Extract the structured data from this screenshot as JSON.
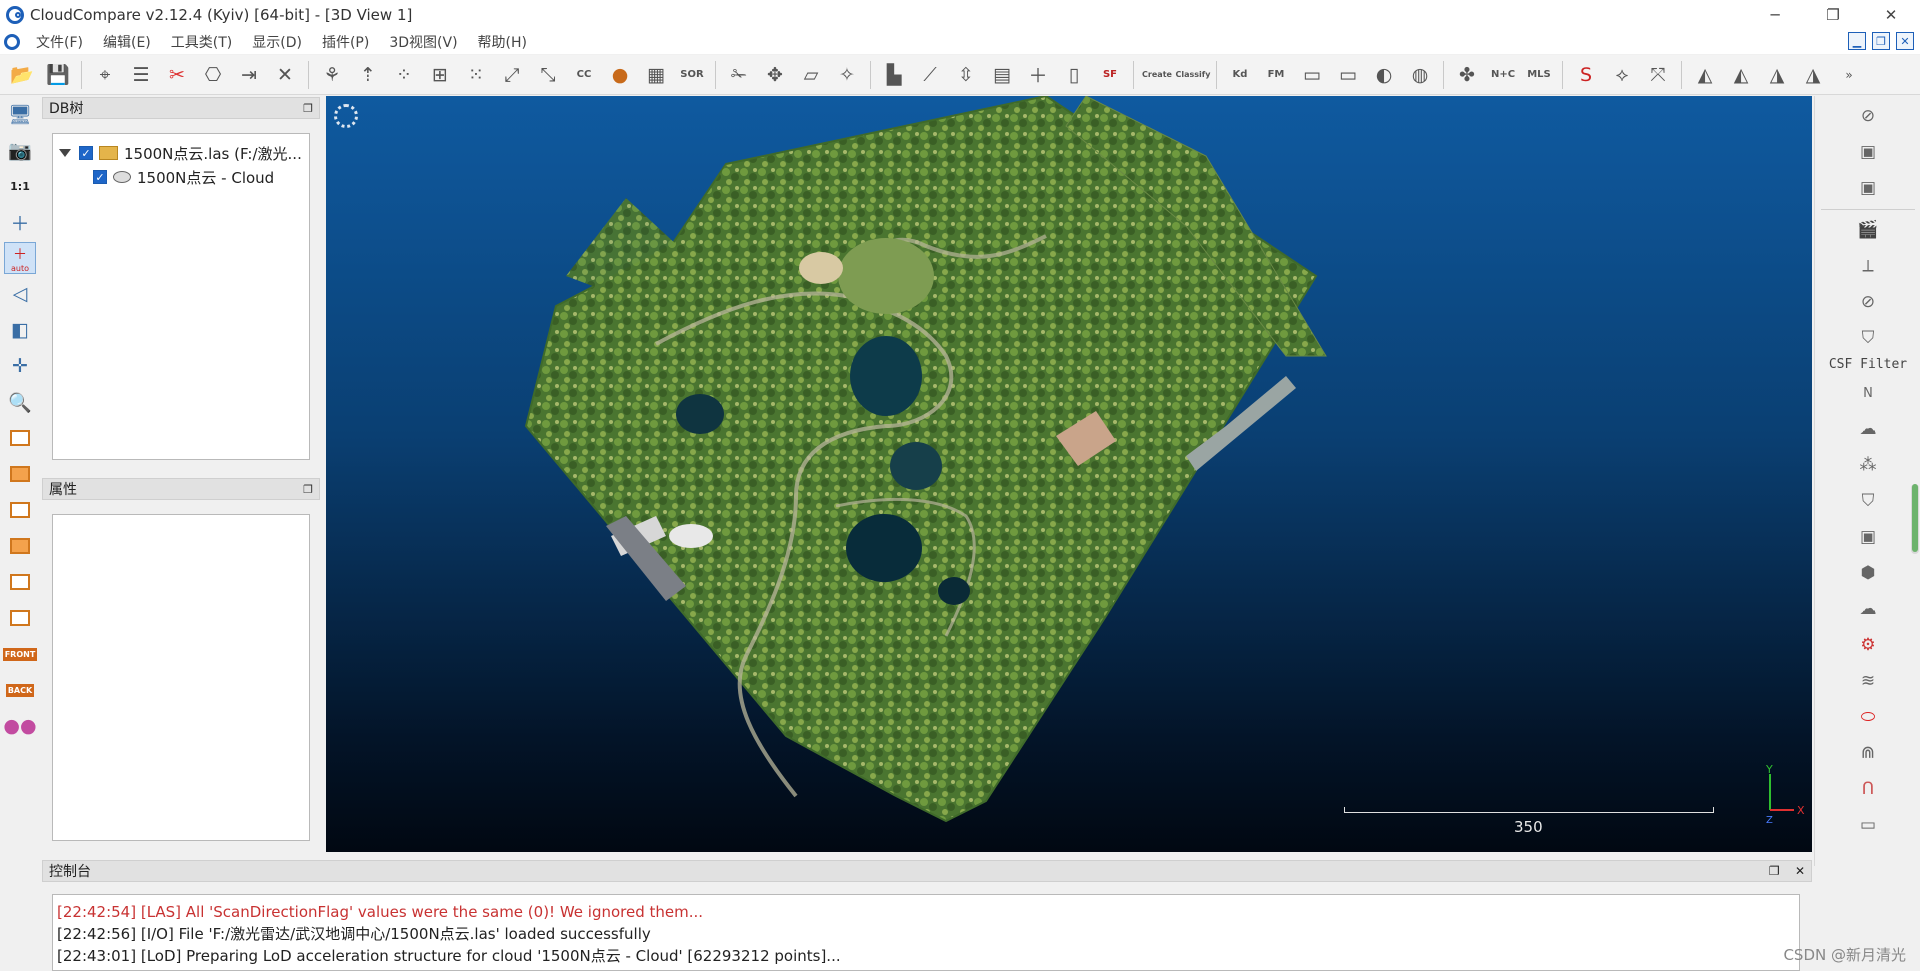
{
  "window": {
    "title": "CloudCompare v2.12.4 (Kyiv) [64-bit] - [3D View 1]",
    "controls": [
      "─",
      "❐",
      "✕"
    ]
  },
  "menubar": {
    "items": [
      "文件(F)",
      "编辑(E)",
      "工具类(T)",
      "显示(D)",
      "插件(P)",
      "3D视图(V)",
      "帮助(H)"
    ],
    "mdi_controls": [
      "▁",
      "❐",
      "✕"
    ]
  },
  "toolbar": {
    "text_buttons": {
      "cc": "CC",
      "sor": "SOR",
      "sf": "SF",
      "canupo_create": "Create",
      "canupo_classify": "Classify",
      "kd": "Kd",
      "fm": "FM",
      "nc": "N+C",
      "mls": "MLS"
    }
  },
  "leftbar": {
    "scale_label": "1:1",
    "auto_label": "auto",
    "front_label": "FRONT",
    "back_label": "BACK"
  },
  "db_tree": {
    "title": "DB树",
    "items": [
      {
        "label": "1500N点云.las (F:/激光...",
        "checked": true,
        "type": "folder"
      },
      {
        "label": "1500N点云 - Cloud",
        "checked": true,
        "type": "cloud"
      }
    ]
  },
  "properties": {
    "title": "属性"
  },
  "view3d": {
    "scale_value": "350",
    "axes": {
      "x": "X",
      "y": "Y",
      "z": "Z"
    }
  },
  "rightbar": {
    "csf_label": "CSF Filter",
    "n_label": "N"
  },
  "console": {
    "title": "控制台",
    "lines": [
      {
        "text": "[22:42:54] [LAS] All 'ScanDirectionFlag' values were the same (0)! We ignored them...",
        "level": "warn"
      },
      {
        "text": "[22:42:56] [I/O] File 'F:/激光雷达/武汉地调中心/1500N点云.las' loaded successfully",
        "level": "info"
      },
      {
        "text": "[22:43:01] [LoD] Preparing LoD acceleration structure for cloud '1500N点云 - Cloud' [62293212 points]...",
        "level": "info"
      }
    ]
  },
  "watermark": "CSDN @新月清光",
  "colors": {
    "accent": "#1e66c8",
    "warning": "#c83232",
    "vegetation": "#4f7a2e",
    "view_top": "#0f5aa0",
    "view_bottom": "#010812"
  }
}
